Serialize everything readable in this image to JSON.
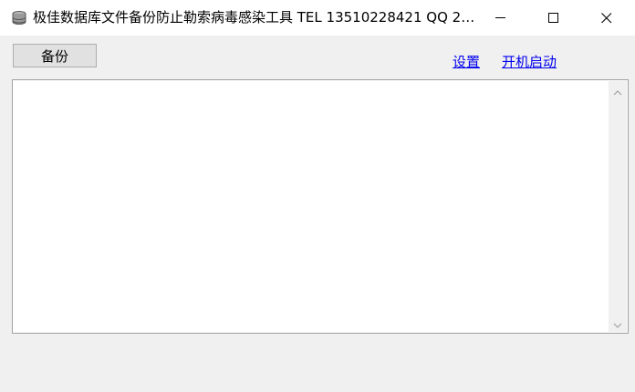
{
  "window": {
    "title": "极佳数据库文件备份防止勒索病毒感染工具 TEL 13510228421 QQ 25..."
  },
  "icons": {
    "app": "app-icon",
    "minimize": "minimize-icon",
    "maximize": "maximize-icon",
    "close": "close-icon",
    "scroll_up": "chevron-up-icon",
    "scroll_down": "chevron-down-icon"
  },
  "toolbar": {
    "backup_label": "备份",
    "settings_link": "设置",
    "autostart_link": "开机启动"
  },
  "log": {
    "content": ""
  },
  "colors": {
    "link": "#0000ee",
    "window_bg": "#f0f0f0",
    "titlebar_bg": "#ffffff"
  }
}
